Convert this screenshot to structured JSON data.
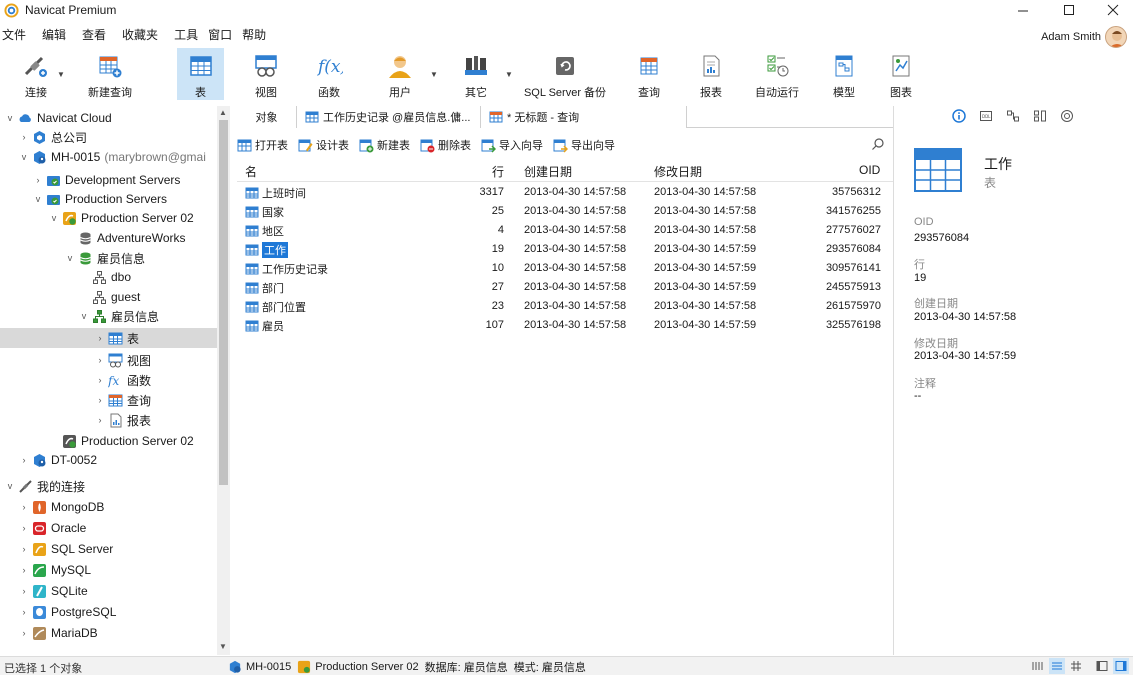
{
  "window": {
    "title": "Navicat Premium"
  },
  "menu": [
    "文件",
    "编辑",
    "查看",
    "收藏夹",
    "工具",
    "窗口",
    "帮助"
  ],
  "user": {
    "name": "Adam Smith"
  },
  "toolbar": [
    {
      "id": "connect",
      "label": "连接",
      "icon": "connect-icon",
      "dropdown": true
    },
    {
      "id": "new-query",
      "label": "新建查询",
      "icon": "new-query-icon"
    },
    {
      "id": "table",
      "label": "表",
      "icon": "table-icon",
      "active": true
    },
    {
      "id": "view",
      "label": "视图",
      "icon": "view-icon"
    },
    {
      "id": "function",
      "label": "函数",
      "icon": "function-icon"
    },
    {
      "id": "user",
      "label": "用户",
      "icon": "user-icon",
      "dropdown": true
    },
    {
      "id": "other",
      "label": "其它",
      "icon": "tools-icon",
      "dropdown": true
    },
    {
      "id": "backup",
      "label": "SQL Server 备份",
      "icon": "backup-icon"
    },
    {
      "id": "query",
      "label": "查询",
      "icon": "query-icon"
    },
    {
      "id": "report",
      "label": "报表",
      "icon": "report-icon"
    },
    {
      "id": "automation",
      "label": "自动运行",
      "icon": "automation-icon"
    },
    {
      "id": "model",
      "label": "模型",
      "icon": "model-icon"
    },
    {
      "id": "chart",
      "label": "图表",
      "icon": "chart-icon"
    }
  ],
  "tree": {
    "navicat_cloud": "Navicat Cloud",
    "company": "总公司",
    "mh0015": "MH-0015",
    "mh0015_user": "(marybrown@gmai",
    "dev_servers": "Development Servers",
    "prod_servers": "Production Servers",
    "prod_server_02": "Production Server 02",
    "adventureworks": "AdventureWorks",
    "employee_info_db": "雇员信息",
    "dbo": "dbo",
    "guest": "guest",
    "employee_info_schema": "雇员信息",
    "tables": "表",
    "views": "视图",
    "functions": "函数",
    "queries": "查询",
    "reports": "报表",
    "prod_server_02b": "Production Server 02",
    "dt0052": "DT-0052",
    "my_connections": "我的连接",
    "mongodb": "MongoDB",
    "oracle": "Oracle",
    "sqlserver": "SQL Server",
    "mysql": "MySQL",
    "sqlite": "SQLite",
    "postgresql": "PostgreSQL",
    "mariadb": "MariaDB"
  },
  "tabs": [
    {
      "label": "对象"
    },
    {
      "label": "工作历史记录 @雇员信息.傭..."
    },
    {
      "label": "* 无标题 - 查询"
    }
  ],
  "objbar": {
    "open": "打开表",
    "design": "设计表",
    "new": "新建表",
    "delete": "删除表",
    "import": "导入向导",
    "export": "导出向导"
  },
  "table_headers": {
    "name": "名",
    "rows": "行",
    "created": "创建日期",
    "modified": "修改日期",
    "oid": "OID"
  },
  "table_rows": [
    {
      "name": "上班时间",
      "rows": "3317",
      "created": "2013-04-30 14:57:58",
      "modified": "2013-04-30 14:57:58",
      "oid": "35756312"
    },
    {
      "name": "国家",
      "rows": "25",
      "created": "2013-04-30 14:57:58",
      "modified": "2013-04-30 14:57:58",
      "oid": "341576255"
    },
    {
      "name": "地区",
      "rows": "4",
      "created": "2013-04-30 14:57:58",
      "modified": "2013-04-30 14:57:58",
      "oid": "277576027"
    },
    {
      "name": "工作",
      "rows": "19",
      "created": "2013-04-30 14:57:58",
      "modified": "2013-04-30 14:57:59",
      "oid": "293576084",
      "selected": true
    },
    {
      "name": "工作历史记录",
      "rows": "10",
      "created": "2013-04-30 14:57:58",
      "modified": "2013-04-30 14:57:59",
      "oid": "309576141"
    },
    {
      "name": "部门",
      "rows": "27",
      "created": "2013-04-30 14:57:58",
      "modified": "2013-04-30 14:57:59",
      "oid": "245575913"
    },
    {
      "name": "部门位置",
      "rows": "23",
      "created": "2013-04-30 14:57:58",
      "modified": "2013-04-30 14:57:58",
      "oid": "261575970"
    },
    {
      "name": "雇员",
      "rows": "107",
      "created": "2013-04-30 14:57:58",
      "modified": "2013-04-30 14:57:59",
      "oid": "325576198"
    }
  ],
  "detail": {
    "title": "工作",
    "type": "表",
    "oid_label": "OID",
    "oid": "293576084",
    "rows_label": "行",
    "rows": "19",
    "created_label": "创建日期",
    "created": "2013-04-30 14:57:58",
    "modified_label": "修改日期",
    "modified": "2013-04-30 14:57:59",
    "comment_label": "注释",
    "comment": "--"
  },
  "status": {
    "selection": "已选择 1 个对象",
    "connection": "MH-0015",
    "server": "Production Server 02",
    "database": "数据库: 雇员信息",
    "schema": "模式: 雇员信息"
  },
  "colors": {
    "selection": "#1e78d7",
    "active_tool": "#cce4f7",
    "table_icon": "#2f7fd1"
  }
}
